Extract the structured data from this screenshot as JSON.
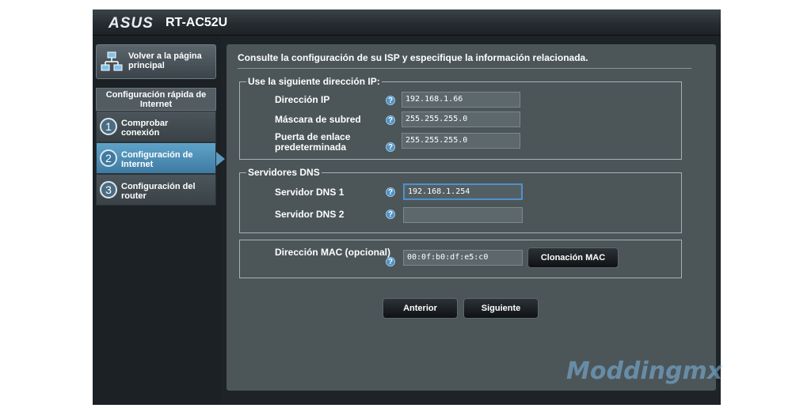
{
  "brand": {
    "logo": "ASUS",
    "model": "RT-AC52U"
  },
  "sidebar": {
    "home_label": "Volver a la página principal",
    "wizard_title": "Configuración rápida de Internet",
    "steps": [
      {
        "num": "1",
        "label": "Comprobar conexión",
        "active": false
      },
      {
        "num": "2",
        "label": "Configuración de Internet",
        "active": true
      },
      {
        "num": "3",
        "label": "Configuración del router",
        "active": false
      }
    ]
  },
  "main": {
    "intro": "Consulte la configuración de su ISP y especifique la información relacionada.",
    "ip_section": {
      "legend": "Use la siguiente dirección IP:",
      "ip_label": "Dirección IP",
      "ip_value": "192.168.1.66",
      "mask_label": "Máscara de subred",
      "mask_value": "255.255.255.0",
      "gateway_label": "Puerta de enlace predeterminada",
      "gateway_value": "255.255.255.0"
    },
    "dns_section": {
      "legend": "Servidores DNS",
      "dns1_label": "Servidor DNS 1",
      "dns1_value": "192.168.1.254",
      "dns2_label": "Servidor DNS 2",
      "dns2_value": ""
    },
    "mac_section": {
      "mac_label": "Dirección MAC (opcional)",
      "mac_value": "00:0f:b0:df:e5:c0",
      "clone_button": "Clonación MAC"
    },
    "help_glyph": "?",
    "prev_button": "Anterior",
    "next_button": "Siguiente"
  },
  "watermark": "Moddingmx",
  "colors": {
    "accent": "#4e91c4",
    "active_step": "#5fa3c9",
    "panel": "#4c5659"
  }
}
